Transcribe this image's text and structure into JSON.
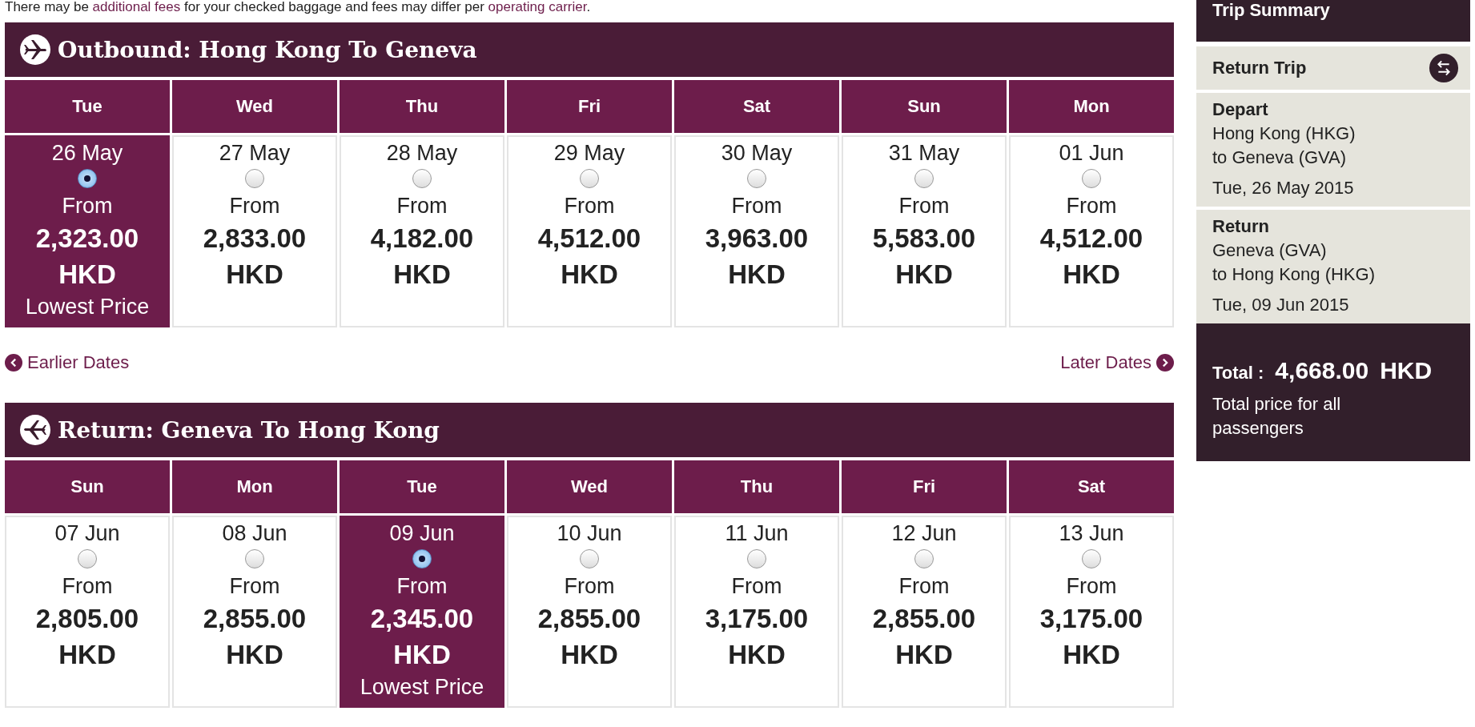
{
  "notice": [
    {
      "kind": "text",
      "text": "There may be "
    },
    {
      "kind": "link",
      "text": "additional fees"
    },
    {
      "kind": "text",
      "text": " for your checked baggage and fees may differ per "
    },
    {
      "kind": "link",
      "text": "operating carrier"
    },
    {
      "kind": "text",
      "text": "."
    }
  ],
  "sections": [
    {
      "kind": "outbound",
      "title": "Outbound: Hong Kong To Geneva",
      "days": [
        {
          "weekday": "Tue",
          "date": "26 May",
          "from": "From",
          "price": "2,323.00",
          "currency": "HKD",
          "selected": true,
          "badge": "Lowest Price"
        },
        {
          "weekday": "Wed",
          "date": "27 May",
          "from": "From",
          "price": "2,833.00",
          "currency": "HKD",
          "selected": false
        },
        {
          "weekday": "Thu",
          "date": "28 May",
          "from": "From",
          "price": "4,182.00",
          "currency": "HKD",
          "selected": false
        },
        {
          "weekday": "Fri",
          "date": "29 May",
          "from": "From",
          "price": "4,512.00",
          "currency": "HKD",
          "selected": false
        },
        {
          "weekday": "Sat",
          "date": "30 May",
          "from": "From",
          "price": "3,963.00",
          "currency": "HKD",
          "selected": false
        },
        {
          "weekday": "Sun",
          "date": "31 May",
          "from": "From",
          "price": "5,583.00",
          "currency": "HKD",
          "selected": false
        },
        {
          "weekday": "Mon",
          "date": "01 Jun",
          "from": "From",
          "price": "4,512.00",
          "currency": "HKD",
          "selected": false
        }
      ],
      "nav": {
        "earlier": "Earlier Dates",
        "later": "Later Dates"
      }
    },
    {
      "kind": "return",
      "title": "Return: Geneva To Hong Kong",
      "days": [
        {
          "weekday": "Sun",
          "date": "07 Jun",
          "from": "From",
          "price": "2,805.00",
          "currency": "HKD",
          "selected": false
        },
        {
          "weekday": "Mon",
          "date": "08 Jun",
          "from": "From",
          "price": "2,855.00",
          "currency": "HKD",
          "selected": false
        },
        {
          "weekday": "Tue",
          "date": "09 Jun",
          "from": "From",
          "price": "2,345.00",
          "currency": "HKD",
          "selected": true,
          "badge": "Lowest Price"
        },
        {
          "weekday": "Wed",
          "date": "10 Jun",
          "from": "From",
          "price": "2,855.00",
          "currency": "HKD",
          "selected": false
        },
        {
          "weekday": "Thu",
          "date": "11 Jun",
          "from": "From",
          "price": "3,175.00",
          "currency": "HKD",
          "selected": false
        },
        {
          "weekday": "Fri",
          "date": "12 Jun",
          "from": "From",
          "price": "2,855.00",
          "currency": "HKD",
          "selected": false
        },
        {
          "weekday": "Sat",
          "date": "13 Jun",
          "from": "From",
          "price": "3,175.00",
          "currency": "HKD",
          "selected": false
        }
      ]
    }
  ],
  "summary": {
    "title": "Trip Summary",
    "trip_type": "Return Trip",
    "legs": [
      {
        "label": "Depart",
        "from": "Hong Kong (HKG)",
        "to": "to Geneva (GVA)",
        "date": "Tue, 26 May 2015"
      },
      {
        "label": "Return",
        "from": "Geneva (GVA)",
        "to": "to Hong Kong (HKG)",
        "date": "Tue, 09 Jun 2015"
      }
    ],
    "total_label": "Total :",
    "total_amount": "4,668.00",
    "total_currency": "HKD",
    "total_note": "Total price for all passengers"
  }
}
